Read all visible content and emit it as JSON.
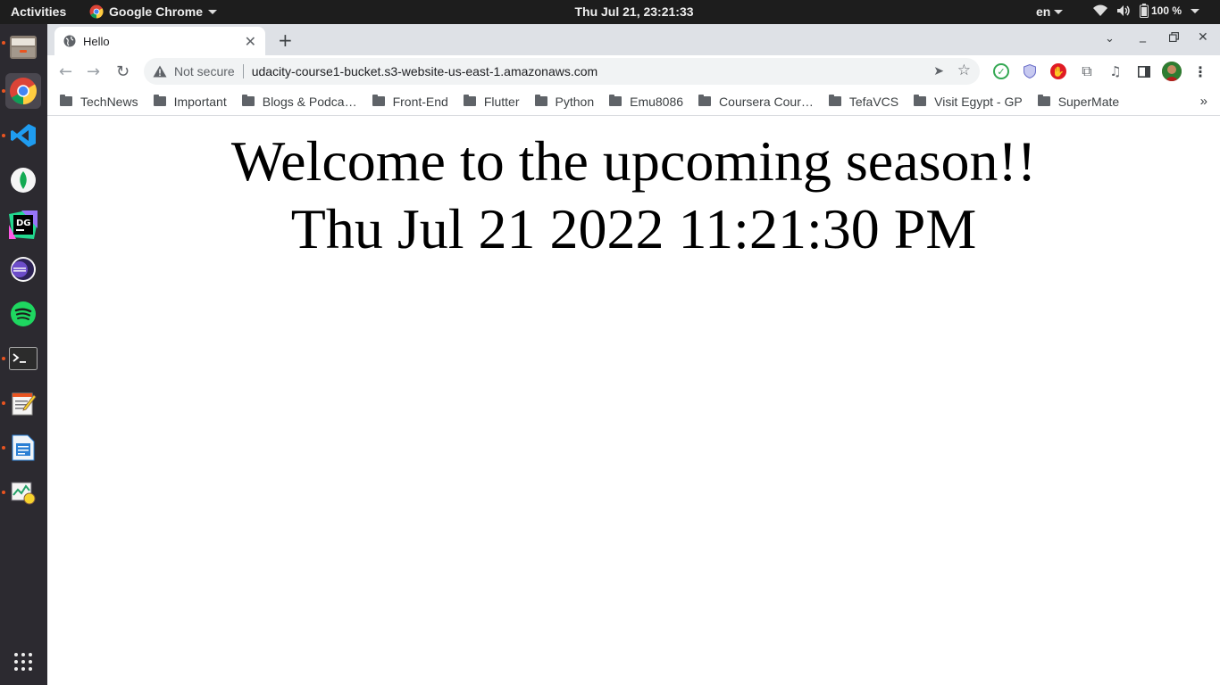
{
  "topbar": {
    "activities": "Activities",
    "app_name": "Google Chrome",
    "clock": "Thu Jul 21, 23:21:33",
    "language": "en",
    "battery": "100 %"
  },
  "dock": {
    "apps": [
      "files",
      "google-chrome",
      "vscode",
      "mongodb-compass",
      "datagrip",
      "eclipse",
      "spotify",
      "terminal",
      "text-editor",
      "libreoffice-writer",
      "system-monitor"
    ]
  },
  "browser": {
    "tab_title": "Hello",
    "security_label": "Not secure",
    "url": "udacity-course1-bucket.s3-website-us-east-1.amazonaws.com",
    "bookmarks": [
      "TechNews",
      "Important",
      "Blogs & Podca…",
      "Front-End",
      "Flutter",
      "Python",
      "Emu8086",
      "Coursera Cour…",
      "TefaVCS",
      "Visit Egypt - GP",
      "SuperMate"
    ],
    "bookmarks_more": "»"
  },
  "page": {
    "heading": "Welcome to the upcoming season!!",
    "datetime": "Thu Jul 21 2022 11:21:30 PM"
  },
  "colors": {
    "topbar_bg": "#1d1d1d",
    "dock_bg": "#2c2a30",
    "tabstrip_bg": "#dee1e6",
    "accent_dot": "#e95420"
  }
}
